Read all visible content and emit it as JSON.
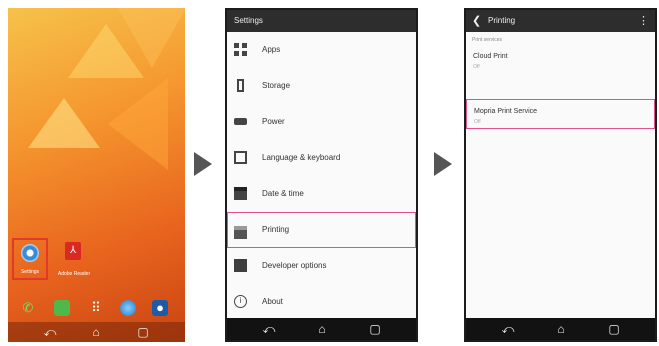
{
  "phone1": {
    "apps": [
      {
        "label": "Settings"
      },
      {
        "label": "Adobe Reader"
      }
    ],
    "dock_icons": [
      "phone-icon",
      "messages-icon",
      "apps-icon",
      "browser-icon",
      "camera-icon"
    ],
    "nav": {
      "back": "⤺",
      "home": "⌂",
      "recent": "▢"
    }
  },
  "phone2": {
    "title": "Settings",
    "items": [
      {
        "label": "Apps",
        "icon": "apps-grid-icon"
      },
      {
        "label": "Storage",
        "icon": "storage-icon"
      },
      {
        "label": "Power",
        "icon": "battery-icon"
      },
      {
        "label": "Language & keyboard",
        "icon": "keyboard-icon"
      },
      {
        "label": "Date & time",
        "icon": "calendar-icon"
      },
      {
        "label": "Printing",
        "icon": "printer-icon",
        "highlighted": true
      },
      {
        "label": "Developer options",
        "icon": "developer-icon"
      },
      {
        "label": "About",
        "icon": "info-icon"
      }
    ],
    "nav": {
      "back": "⤺",
      "home": "⌂",
      "recent": "▢"
    }
  },
  "phone3": {
    "title": "Printing",
    "section_label": "Print services",
    "services": [
      {
        "name": "Cloud Print",
        "state": "Off"
      },
      {
        "name": "Mopria Print Service",
        "state": "Off",
        "highlighted": true
      }
    ],
    "nav": {
      "back": "⤺",
      "home": "⌂",
      "recent": "▢"
    }
  },
  "colors": {
    "highlight": "#e0508a",
    "home_highlight": "#e03a2a",
    "arrow": "#555555",
    "action_bar": "#2d2d2d"
  }
}
